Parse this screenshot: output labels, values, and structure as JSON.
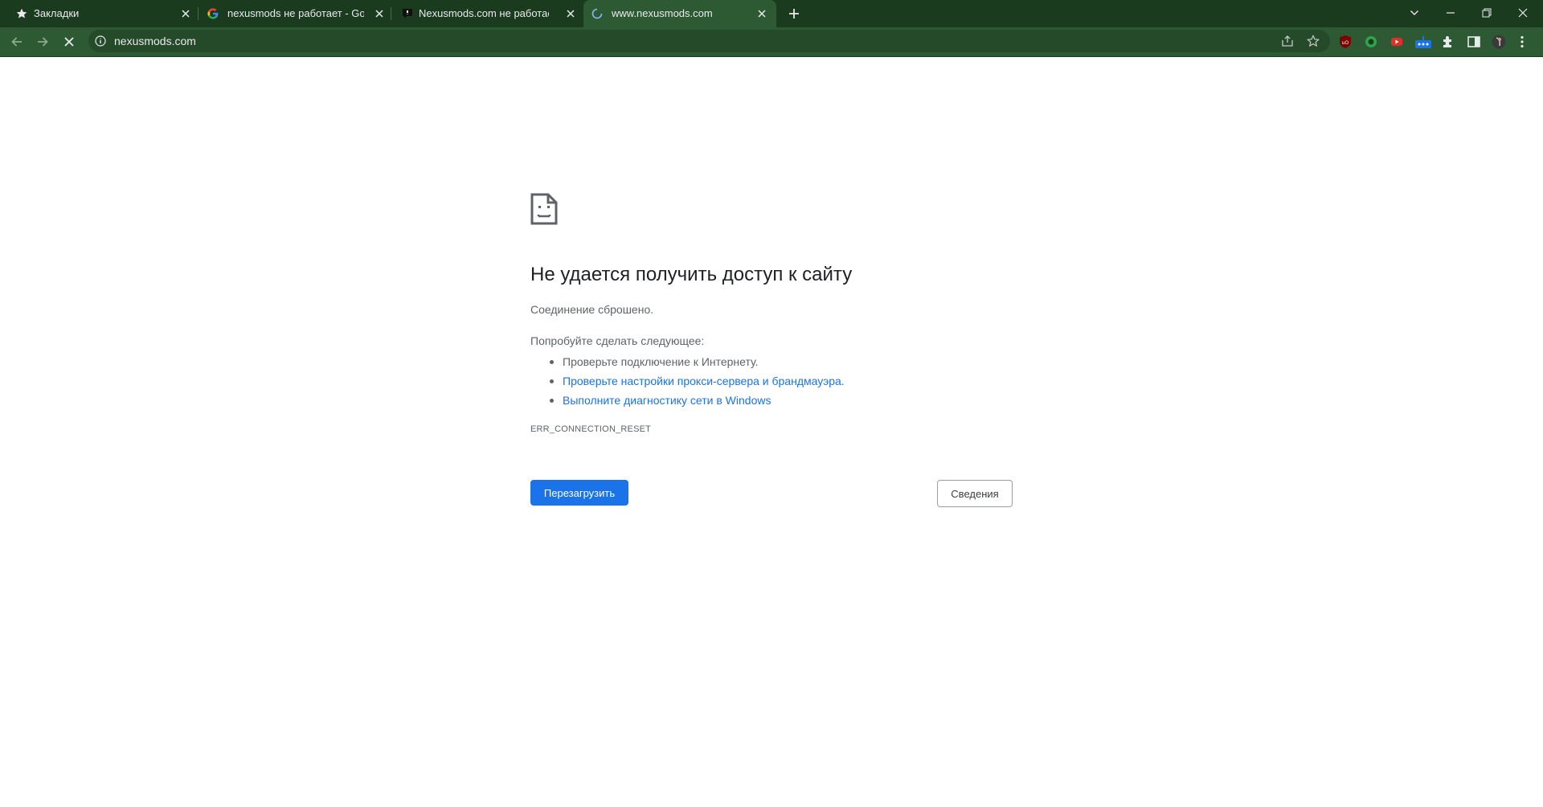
{
  "browser": {
    "tabs": [
      {
        "title": "Закладки",
        "icon": "star-icon",
        "active": false
      },
      {
        "title": "nexusmods не работает - Google",
        "icon": "google-icon",
        "active": false
      },
      {
        "title": "Nexusmods.com не работает се",
        "icon": "site-favicon-icon",
        "active": false
      },
      {
        "title": "www.nexusmods.com",
        "icon": "loading-spinner-icon",
        "active": true
      }
    ],
    "address": "nexusmods.com",
    "colors": {
      "tabstrip": "#1b3b1e",
      "toolbar": "#2d5a33",
      "omnibox": "#254a29",
      "link": "#1a73e8"
    }
  },
  "error": {
    "icon": "sad-document-icon",
    "heading": "Не удается получить доступ к сайту",
    "reason": "Соединение сброшено.",
    "try_label": "Попробуйте сделать следующее:",
    "suggestions": [
      "Проверьте подключение к Интернету.",
      "Проверьте настройки прокси-сервера и брандмауэра.",
      "Выполните диагностику сети в Windows"
    ],
    "code": "ERR_CONNECTION_RESET",
    "reload_label": "Перезагрузить",
    "details_label": "Сведения"
  }
}
